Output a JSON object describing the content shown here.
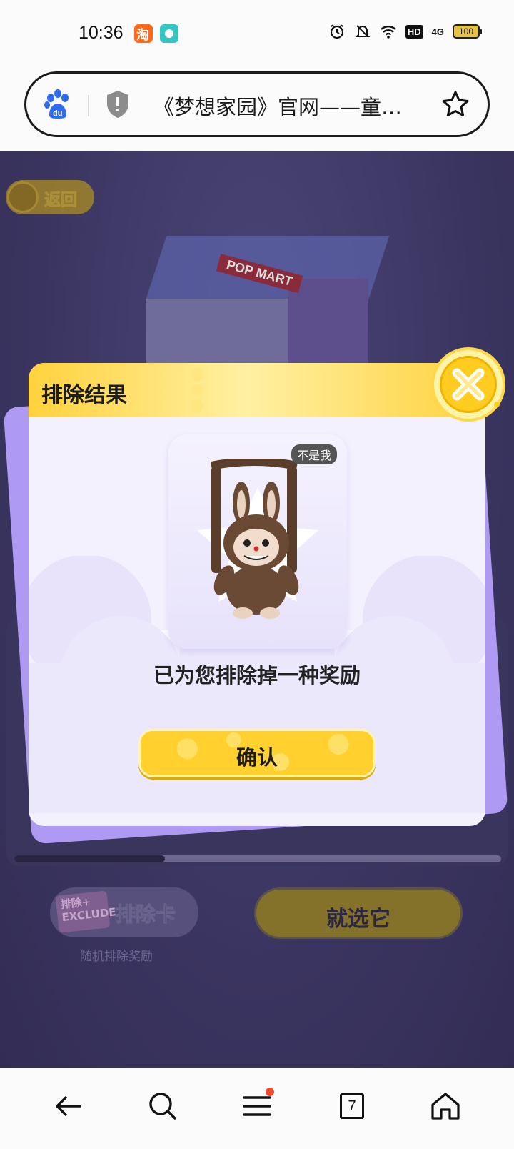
{
  "status_bar": {
    "time": "10:36",
    "battery": "100",
    "network": "4G",
    "hd": "HD"
  },
  "browser": {
    "url_title": "《梦想家园》官网——童…",
    "tab_count": "7"
  },
  "page": {
    "back_label": "返回",
    "exclude_card_label": "排除卡",
    "exclude_card_sub": "随机排除奖励",
    "ticket_text": "排除+ EXCLUDE",
    "choose_label": "就选它",
    "box_label": "POP MART",
    "carousel_progress": 0.31
  },
  "modal": {
    "title": "排除结果",
    "badge": "不是我",
    "result_text": "已为您排除掉一种奖励",
    "confirm_label": "确认"
  },
  "colors": {
    "accent_yellow": "#ffd02e",
    "overlay_purple": "#3f3a64",
    "card_lavender": "#ae9af3"
  }
}
